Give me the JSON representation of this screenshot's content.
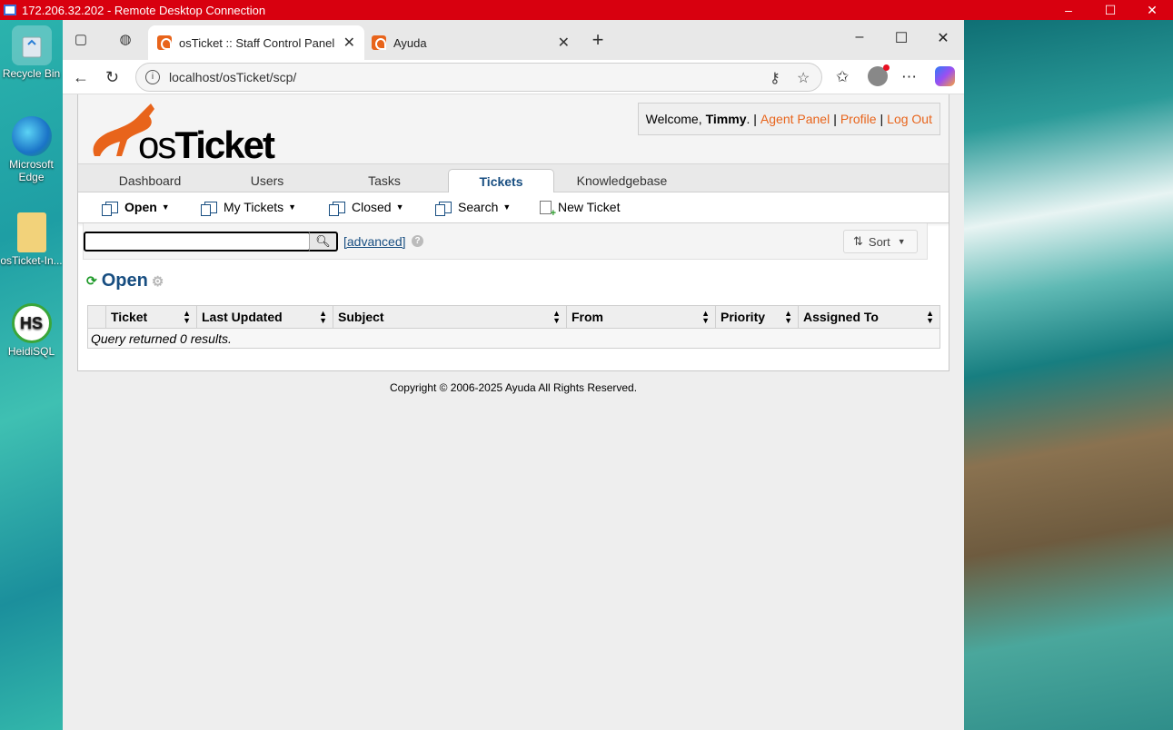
{
  "rdp": {
    "title": "172.206.32.202 - Remote Desktop Connection",
    "minimize": "–",
    "maximize": "☐",
    "close": "✕"
  },
  "desktop": {
    "icons": [
      {
        "label": "Recycle Bin"
      },
      {
        "label": "Microsoft Edge"
      },
      {
        "label": "osTicket-In..."
      },
      {
        "label": "HeidiSQL",
        "glyph": "HS"
      }
    ]
  },
  "browser": {
    "tabs": [
      {
        "label": "osTicket :: Staff Control Panel"
      },
      {
        "label": "Ayuda"
      }
    ],
    "new_tab": "+",
    "url": "localhost/osTicket/scp/"
  },
  "header": {
    "logo_os": "os",
    "logo_ticket": "Ticket",
    "welcome": "Welcome,",
    "username": "Timmy",
    "after_name": ". |",
    "agent_panel": "Agent Panel",
    "sep1": "|",
    "profile": "Profile",
    "sep2": "|",
    "logout": "Log Out"
  },
  "nav": {
    "tabs": [
      "Dashboard",
      "Users",
      "Tasks",
      "Tickets",
      "Knowledgebase"
    ],
    "active": "Tickets"
  },
  "subnav": {
    "items": [
      "Open",
      "My Tickets",
      "Closed",
      "Search",
      "New Ticket"
    ]
  },
  "search": {
    "value": "",
    "advanced": "[advanced]",
    "help": "?",
    "sort": "Sort"
  },
  "queue": {
    "title": "Open"
  },
  "table": {
    "columns": [
      "Ticket",
      "Last Updated",
      "Subject",
      "From",
      "Priority",
      "Assigned To"
    ],
    "empty_message": "Query returned 0 results."
  },
  "footer": {
    "copyright": "Copyright © 2006-2025 Ayuda All Rights Reserved."
  },
  "colors": {
    "accent": "#e8641b",
    "nav_blue": "#184e81",
    "rdp_red": "#d8000f"
  }
}
